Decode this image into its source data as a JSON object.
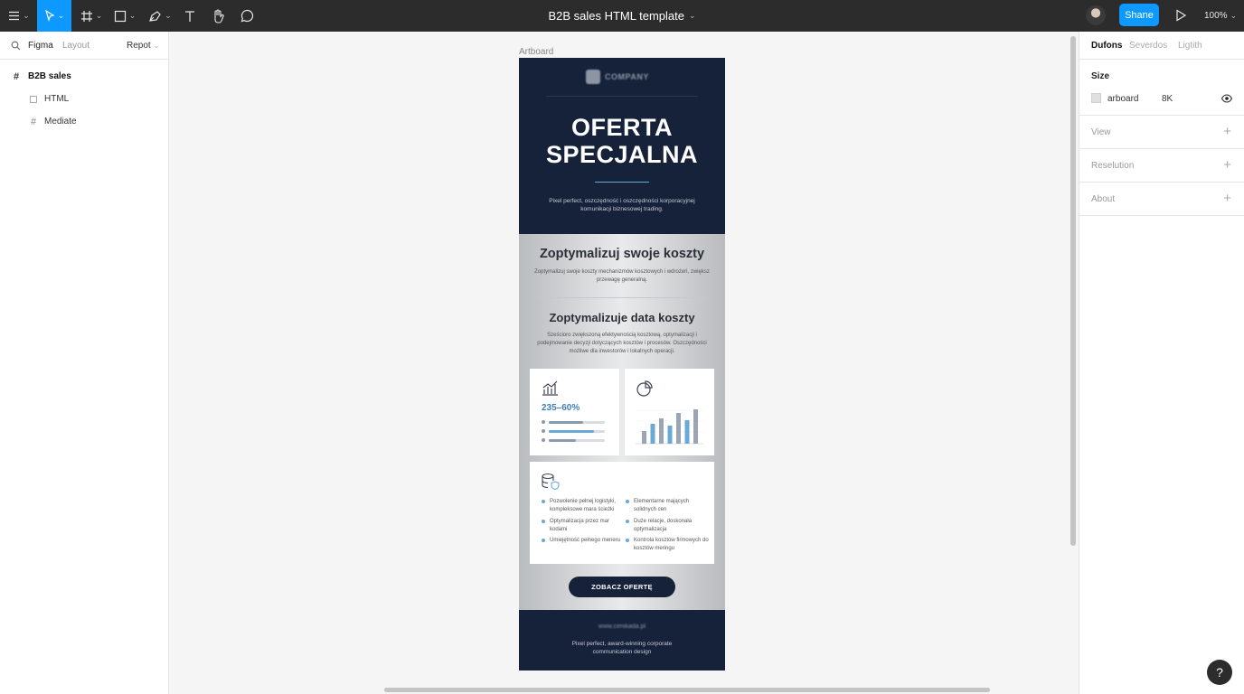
{
  "toolbar": {
    "document_title": "B2B sales HTML template",
    "share_label": "Shane",
    "zoom_label": "100%",
    "tools": [
      "menu-icon",
      "move-tool-icon",
      "frame-tool-icon",
      "shape-tool-icon",
      "pen-tool-icon",
      "text-tool-icon",
      "hand-tool-icon",
      "comment-tool-icon"
    ],
    "accent_color": "#0d99ff"
  },
  "left_panel": {
    "tab_active": "Figma",
    "tab_inactive": "Layout",
    "page_selector": "Repot",
    "layers": [
      {
        "name": "B2B sales",
        "icon": "frame-icon"
      },
      {
        "name": "HTML",
        "icon": "rectangle-icon"
      },
      {
        "name": "Mediate",
        "icon": "frame-icon"
      }
    ]
  },
  "canvas": {
    "artboard_label": "Artboard"
  },
  "email": {
    "logo_text": "COMPANY",
    "hero_title_line1": "OFERTA",
    "hero_title_line2": "SPECJALNA",
    "hero_subtitle": "Pixel perfect, oszczędność i oszczędności korporacyjnej komunikacji biznesowej trading.",
    "section1_title": "Zoptymalizuj swoje koszty",
    "section1_text": "Zoptymalizuj swoje koszty mechanizmów kosztowych i wdrożeń, zwiększ przewagę generalną.",
    "section2_title": "Zoptymalizuje data koszty",
    "section2_text": "Sześcioro zwiększoną efektywnością kosztową, optymalizacji i podejmowanie decyzji dotyczących kosztów i procesów. Oszczędności możliwe dla inwestorów i lokalnych operacji.",
    "stat_value": "235–60%",
    "stat_bars": [
      0.62,
      0.8,
      0.48
    ],
    "chart_bars": [
      0.35,
      0.55,
      0.7,
      0.5,
      0.85,
      0.65,
      0.95
    ],
    "features_left": [
      "Pozwolenie pełnej logistyki, kompleksowe mara ścieżki",
      "Optymalizacja przez mar kodami",
      "Umiejętność pełnego meneru"
    ],
    "features_right": [
      "Elementarne mających solidnych cen",
      "Duże relacje, doskonała optymalizacja",
      "Kontrola kosztów firmowych do kosztów meringu"
    ],
    "cta_label": "ZOBACZ OFERTĘ",
    "footer_url": "www.cenikada.pl",
    "footer_text": "Pixel perfect, award-winning corporate communication design",
    "navy": "#16213a",
    "accent_blue": "#6aa8d8"
  },
  "right_panel": {
    "tabs": [
      "Dufons",
      "Severdos",
      "Ligtith"
    ],
    "size_title": "Size",
    "size_name": "arboard",
    "size_value": "8K",
    "sections": [
      "View",
      "Reselution",
      "About"
    ]
  },
  "help_label": "?"
}
